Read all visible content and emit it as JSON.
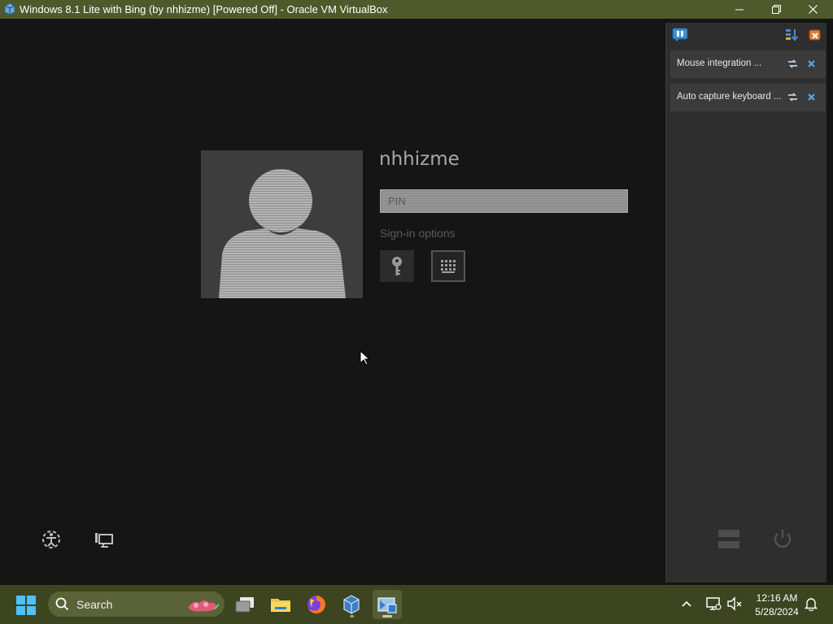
{
  "window": {
    "title": "Windows 8.1 Lite with Bing (by nhhizme) [Powered Off] - Oracle VM VirtualBox"
  },
  "lockscreen": {
    "username": "nhhizme",
    "pin_placeholder": "PIN",
    "signin_options_label": "Sign-in options"
  },
  "notifications": {
    "items": [
      {
        "text": "Mouse integration ..."
      },
      {
        "text": "Auto capture keyboard ..."
      }
    ]
  },
  "taskbar": {
    "search_label": "Search",
    "clock_time": "12:16 AM",
    "clock_date": "5/28/2024"
  },
  "colors": {
    "titlebar": "#4f5a2c",
    "taskbar": "#3c4520",
    "vm_background": "#151515",
    "panel": "#2e2e2e"
  }
}
